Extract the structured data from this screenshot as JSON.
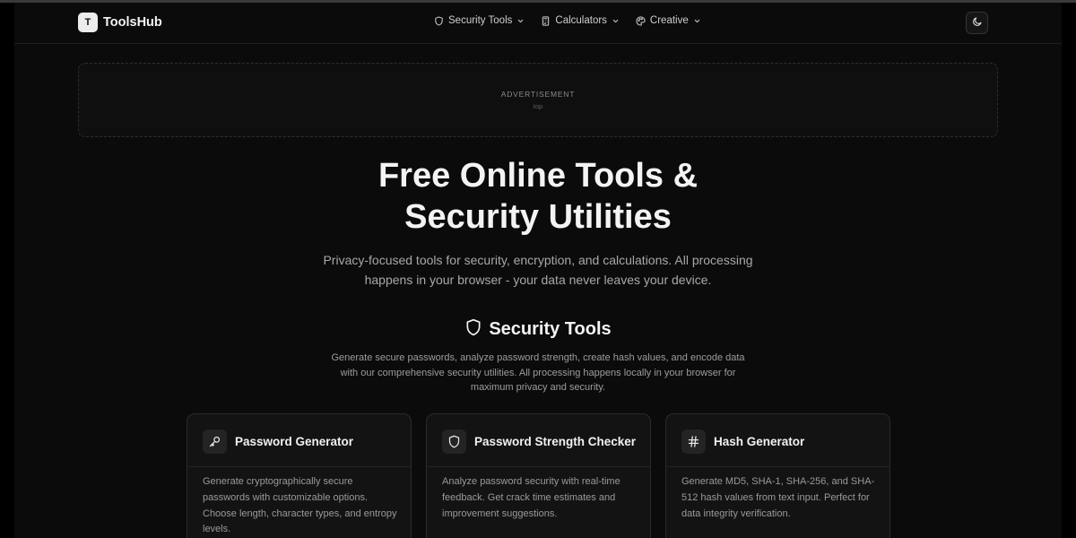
{
  "header": {
    "logo_letter": "T",
    "brand": "ToolsHub",
    "nav": [
      {
        "label": "Security Tools",
        "icon": "shield-icon"
      },
      {
        "label": "Calculators",
        "icon": "calculator-icon"
      },
      {
        "label": "Creative",
        "icon": "palette-icon"
      }
    ],
    "theme_toggle_icon": "moon-icon"
  },
  "ad": {
    "label": "ADVERTISEMENT",
    "slot": "top"
  },
  "hero": {
    "title_line1": "Free Online Tools &",
    "title_line2": "Security Utilities",
    "subtitle": "Privacy-focused tools for security, encryption, and calculations. All processing happens in your browser - your data never leaves your device."
  },
  "section": {
    "icon": "shield-icon",
    "title": "Security Tools",
    "description": "Generate secure passwords, analyze password strength, create hash values, and encode data with our comprehensive security utilities. All processing happens locally in your browser for maximum privacy and security."
  },
  "cards": [
    {
      "title": "Password Generator",
      "icon": "key-icon",
      "description": "Generate cryptographically secure passwords with customizable options. Choose length, character types, and entropy levels."
    },
    {
      "title": "Password Strength Checker",
      "icon": "shield-icon",
      "description": "Analyze password security with real-time feedback. Get crack time estimates and improvement suggestions."
    },
    {
      "title": "Hash Generator",
      "icon": "hash-icon",
      "description": "Generate MD5, SHA-1, SHA-256, and SHA-512 hash values from text input. Perfect for data integrity verification."
    }
  ],
  "colors": {
    "background": "#0b0b0b",
    "card": "#131313",
    "text": "#f3f3f3",
    "muted": "#a8a8a8"
  }
}
